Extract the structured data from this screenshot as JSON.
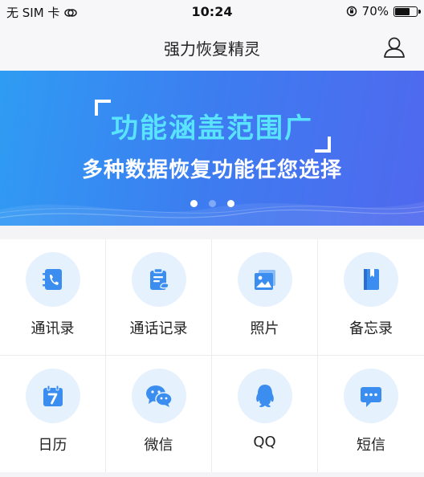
{
  "status_bar": {
    "carrier": "无 SIM 卡",
    "time": "10:24",
    "battery_percent": "70%",
    "battery_level": 0.7
  },
  "nav": {
    "title": "强力恢复精灵"
  },
  "banner": {
    "title": "功能涵盖范围广",
    "subtitle": "多种数据恢复功能任您选择",
    "dots_count": 3,
    "active_dots": [
      0,
      2
    ]
  },
  "features": [
    {
      "label": "通讯录",
      "icon": "contacts-icon"
    },
    {
      "label": "通话记录",
      "icon": "call-log-icon"
    },
    {
      "label": "照片",
      "icon": "photos-icon"
    },
    {
      "label": "备忘录",
      "icon": "notes-icon"
    },
    {
      "label": "日历",
      "icon": "calendar-icon"
    },
    {
      "label": "微信",
      "icon": "wechat-icon"
    },
    {
      "label": "QQ",
      "icon": "qq-icon"
    },
    {
      "label": "短信",
      "icon": "sms-icon"
    }
  ],
  "colors": {
    "accent": "#3d7cf0",
    "icon_blue": "#3b8ef0",
    "icon_bg": "#e6f1fe",
    "banner_title": "#59e3ff"
  }
}
